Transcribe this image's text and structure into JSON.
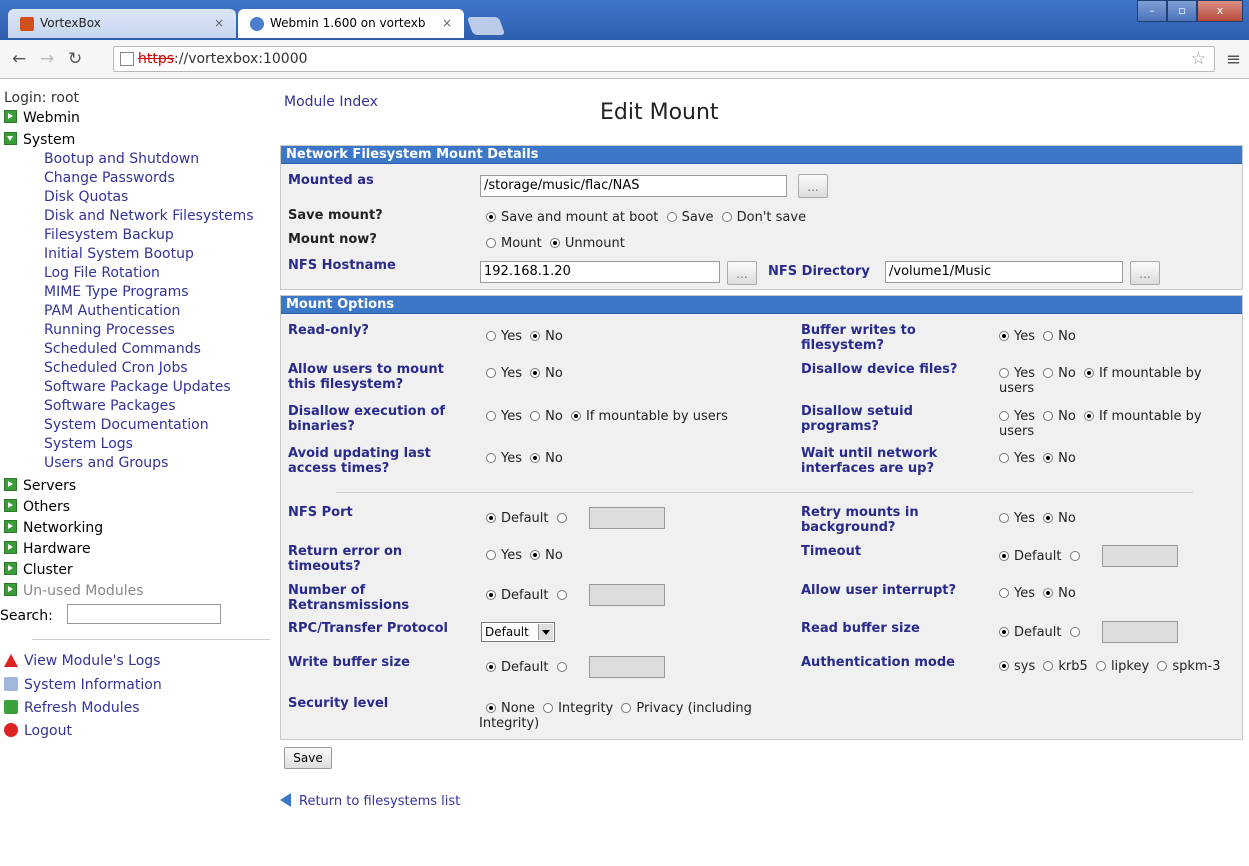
{
  "browser": {
    "tabs": [
      {
        "label": "VortexBox",
        "favicon_color": "#d24f1e"
      },
      {
        "label": "Webmin 1.600 on vortexb",
        "favicon_color": "#4a7fd0"
      }
    ],
    "url_scheme": "https",
    "url_rest": "://vortexbox:10000"
  },
  "left": {
    "login": "Login: root",
    "categories": {
      "webmin": "Webmin",
      "system": "System",
      "servers": "Servers",
      "others": "Others",
      "networking": "Networking",
      "hardware": "Hardware",
      "cluster": "Cluster",
      "unused": "Un-used Modules"
    },
    "system_items": [
      "Bootup and Shutdown",
      "Change Passwords",
      "Disk Quotas",
      "Disk and Network Filesystems",
      "Filesystem Backup",
      "Initial System Bootup",
      "Log File Rotation",
      "MIME Type Programs",
      "PAM Authentication",
      "Running Processes",
      "Scheduled Commands",
      "Scheduled Cron Jobs",
      "Software Package Updates",
      "Software Packages",
      "System Documentation",
      "System Logs",
      "Users and Groups"
    ],
    "search_label": "Search:",
    "actions": {
      "view_logs": "View Module's Logs",
      "system_info": "System Information",
      "refresh": "Refresh Modules",
      "logout": "Logout"
    }
  },
  "page": {
    "module_index": "Module Index",
    "title": "Edit Mount",
    "dots": "...",
    "yes": "Yes",
    "no": "No",
    "default": "Default",
    "if_mountable": "If mountable by users",
    "details": {
      "header": "Network Filesystem Mount Details",
      "mounted_as_label": "Mounted as",
      "mounted_as_value": "/storage/music/flac/NAS",
      "save_mount_label": "Save mount?",
      "save_mount_options": [
        "Save and mount at boot",
        "Save",
        "Don't save"
      ],
      "mount_now_label": "Mount now?",
      "mount_now_options": [
        "Mount",
        "Unmount"
      ],
      "nfs_hostname_label": "NFS Hostname",
      "nfs_hostname_value": "192.168.1.20",
      "nfs_directory_label": "NFS Directory",
      "nfs_directory_value": "/volume1/Music"
    },
    "options": {
      "header": "Mount Options",
      "read_only": "Read-only?",
      "buffer_writes": "Buffer writes to filesystem?",
      "allow_users_mount": "Allow users to mount this filesystem?",
      "disallow_device": "Disallow device files?",
      "disallow_exec": "Disallow execution of binaries?",
      "disallow_setuid": "Disallow setuid programs?",
      "avoid_atime": "Avoid updating last access times?",
      "wait_network": "Wait until network interfaces are up?",
      "nfs_port": "NFS Port",
      "retry_bg": "Retry mounts in background?",
      "return_error": "Return error on timeouts?",
      "timeout": "Timeout",
      "num_retrans": "Number of Retransmissions",
      "allow_interrupt": "Allow user interrupt?",
      "rpc_protocol": "RPC/Transfer Protocol",
      "rpc_value": "Default",
      "read_buffer": "Read buffer size",
      "write_buffer": "Write buffer size",
      "auth_mode": "Authentication mode",
      "auth_options": [
        "sys",
        "krb5",
        "lipkey",
        "spkm-3"
      ],
      "security_level": "Security level",
      "security_options": [
        "None",
        "Integrity",
        "Privacy (including Integrity)"
      ]
    },
    "save_button": "Save",
    "return_link": "Return to filesystems list"
  }
}
